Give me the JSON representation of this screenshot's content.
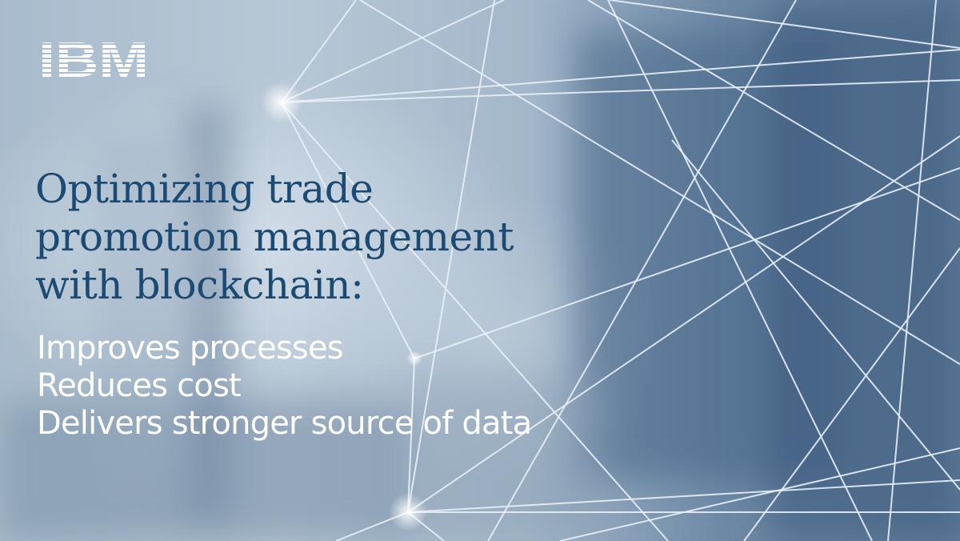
{
  "brand": {
    "name": "IBM",
    "logo_color": "#ffffff"
  },
  "headline": {
    "lines": [
      "Optimizing trade",
      "promotion management",
      "with blockchain:"
    ],
    "color": "#1b4a72"
  },
  "benefits": [
    "Improves processes",
    "Reduces cost",
    "Delivers stronger source of data"
  ],
  "colors": {
    "benefit_text": "#ffffff",
    "network_lines": "#e8f0f7"
  },
  "decor": {
    "network_icon": "blockchain-network-icon"
  }
}
